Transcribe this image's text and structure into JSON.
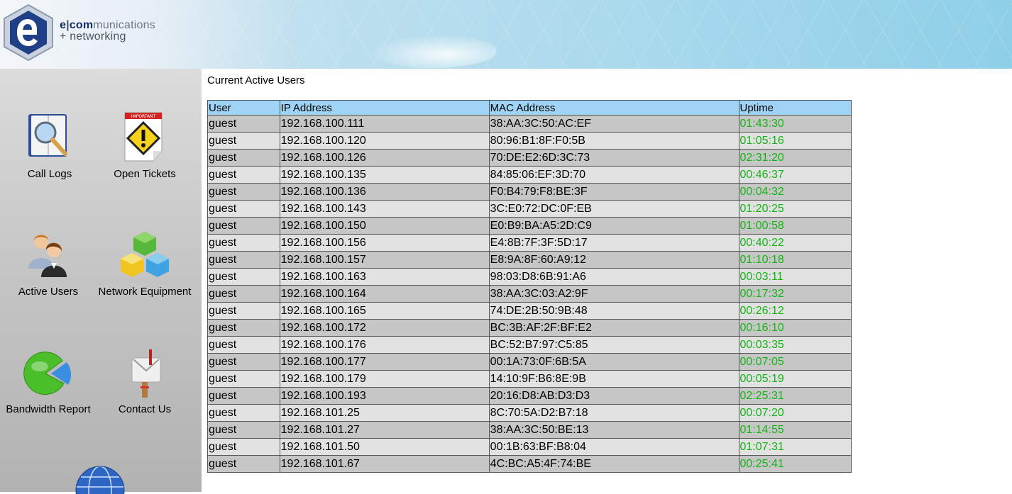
{
  "header": {
    "logo_line1_e": "e",
    "logo_line1_sep": "|",
    "logo_line1_com": "com",
    "logo_line1_rest": "munications",
    "logo_line2": "+ networking"
  },
  "sidebar": {
    "items": [
      {
        "label": "Call Logs",
        "icon": "call-logs-icon"
      },
      {
        "label": "Open Tickets",
        "icon": "important-ticket-icon"
      },
      {
        "label": "Active Users",
        "icon": "users-icon"
      },
      {
        "label": "Network Equipment",
        "icon": "network-cubes-icon"
      },
      {
        "label": "Bandwidth Report",
        "icon": "pie-chart-icon"
      },
      {
        "label": "Contact Us",
        "icon": "mailbox-icon"
      }
    ],
    "ticket_badge": "IMPORTANT"
  },
  "main": {
    "title": "Current Active Users",
    "table": {
      "columns": [
        "User",
        "IP Address",
        "MAC Address",
        "Uptime"
      ],
      "rows": [
        [
          "guest",
          "192.168.100.111",
          "38:AA:3C:50:AC:EF",
          "01:43:30"
        ],
        [
          "guest",
          "192.168.100.120",
          "80:96:B1:8F:F0:5B",
          "01:05:16"
        ],
        [
          "guest",
          "192.168.100.126",
          "70:DE:E2:6D:3C:73",
          "02:31:20"
        ],
        [
          "guest",
          "192.168.100.135",
          "84:85:06:EF:3D:70",
          "00:46:37"
        ],
        [
          "guest",
          "192.168.100.136",
          "F0:B4:79:F8:BE:3F",
          "00:04:32"
        ],
        [
          "guest",
          "192.168.100.143",
          "3C:E0:72:DC:0F:EB",
          "01:20:25"
        ],
        [
          "guest",
          "192.168.100.150",
          "E0:B9:BA:A5:2D:C9",
          "01:00:58"
        ],
        [
          "guest",
          "192.168.100.156",
          "E4:8B:7F:3F:5D:17",
          "00:40:22"
        ],
        [
          "guest",
          "192.168.100.157",
          "E8:9A:8F:60:A9:12",
          "01:10:18"
        ],
        [
          "guest",
          "192.168.100.163",
          "98:03:D8:6B:91:A6",
          "00:03:11"
        ],
        [
          "guest",
          "192.168.100.164",
          "38:AA:3C:03:A2:9F",
          "00:17:32"
        ],
        [
          "guest",
          "192.168.100.165",
          "74:DE:2B:50:9B:48",
          "00:26:12"
        ],
        [
          "guest",
          "192.168.100.172",
          "BC:3B:AF:2F:BF:E2",
          "00:16:10"
        ],
        [
          "guest",
          "192.168.100.176",
          "BC:52:B7:97:C5:85",
          "00:03:35"
        ],
        [
          "guest",
          "192.168.100.177",
          "00:1A:73:0F:6B:5A",
          "00:07:05"
        ],
        [
          "guest",
          "192.168.100.179",
          "14:10:9F:B6:8E:9B",
          "00:05:19"
        ],
        [
          "guest",
          "192.168.100.193",
          "20:16:D8:AB:D3:D3",
          "02:25:31"
        ],
        [
          "guest",
          "192.168.101.25",
          "8C:70:5A:D2:B7:18",
          "00:07:20"
        ],
        [
          "guest",
          "192.168.101.27",
          "38:AA:3C:50:BE:13",
          "01:14:55"
        ],
        [
          "guest",
          "192.168.101.50",
          "00:1B:63:BF:B8:04",
          "01:07:31"
        ],
        [
          "guest",
          "192.168.101.67",
          "4C:BC:A5:4F:74:BE",
          "00:25:41"
        ]
      ]
    }
  },
  "colors": {
    "header_row": "#9fd3f5",
    "row_dark": "#c6c6c6",
    "row_light": "#e2e2e2",
    "uptime_text": "#16b316"
  }
}
